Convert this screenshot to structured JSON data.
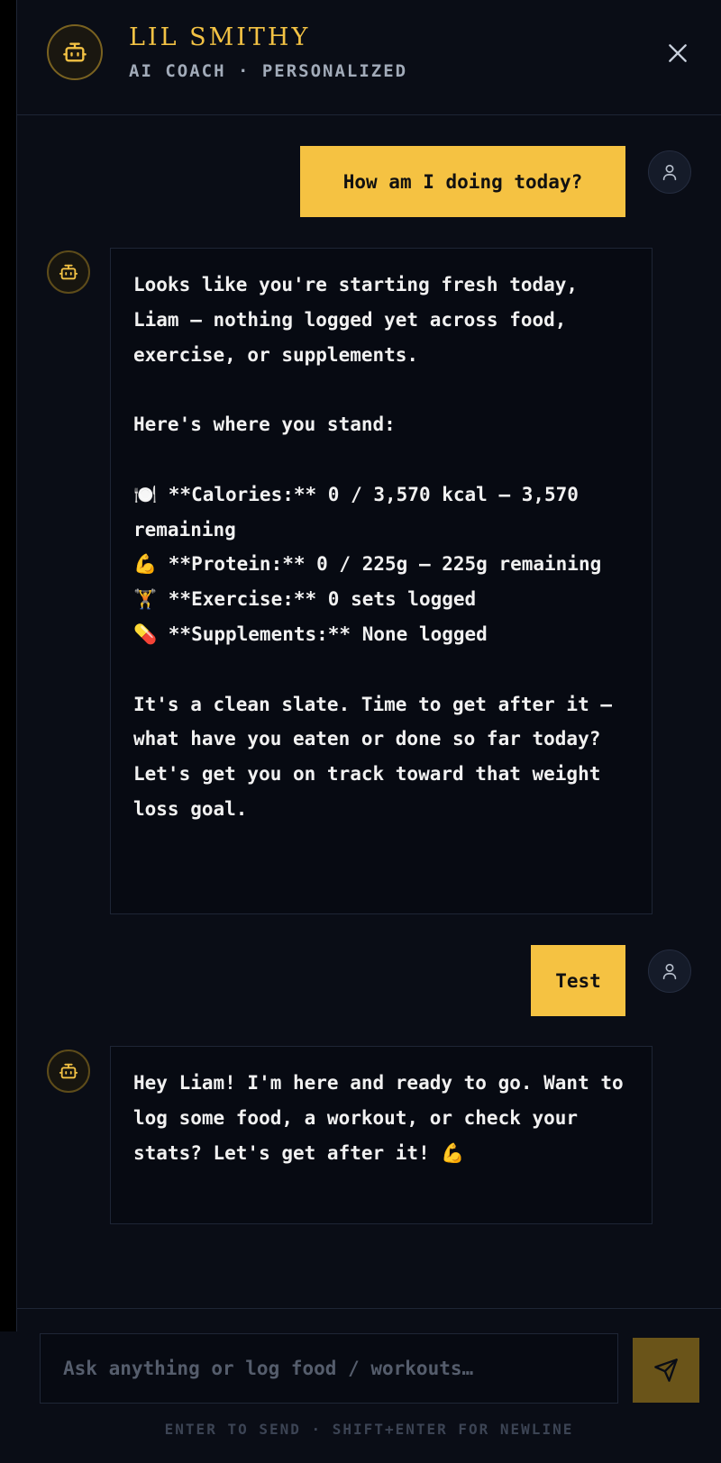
{
  "header": {
    "title": "LIL SMITHY",
    "subtitle": "AI COACH · PERSONALIZED",
    "avatar_icon": "robot-icon",
    "close_icon": "close-icon"
  },
  "colors": {
    "accent": "#f5c242",
    "background": "#0a0d16",
    "bubble_bot": "#070a12"
  },
  "messages": [
    {
      "role": "user",
      "text": "How am I doing today?"
    },
    {
      "role": "assistant",
      "text": "Looks like you're starting fresh today, Liam — nothing logged yet across food, exercise, or supplements.\n\nHere's where you stand:\n\n🍽️ **Calories:** 0 / 3,570 kcal — 3,570 remaining\n💪 **Protein:** 0 / 225g — 225g remaining\n🏋️ **Exercise:** 0 sets logged\n💊 **Supplements:** None logged\n\nIt's a clean slate. Time to get after it — what have you eaten or done so far today? Let's get you on track toward that weight loss goal."
    },
    {
      "role": "user",
      "text": "Test"
    },
    {
      "role": "assistant",
      "text": "Hey Liam! I'm here and ready to go. Want to log some food, a workout, or check your stats? Let's get after it! 💪"
    }
  ],
  "composer": {
    "placeholder": "Ask anything or log food / workouts…",
    "value": "",
    "send_icon": "send-icon",
    "hint": "ENTER TO SEND · SHIFT+ENTER FOR NEWLINE"
  }
}
